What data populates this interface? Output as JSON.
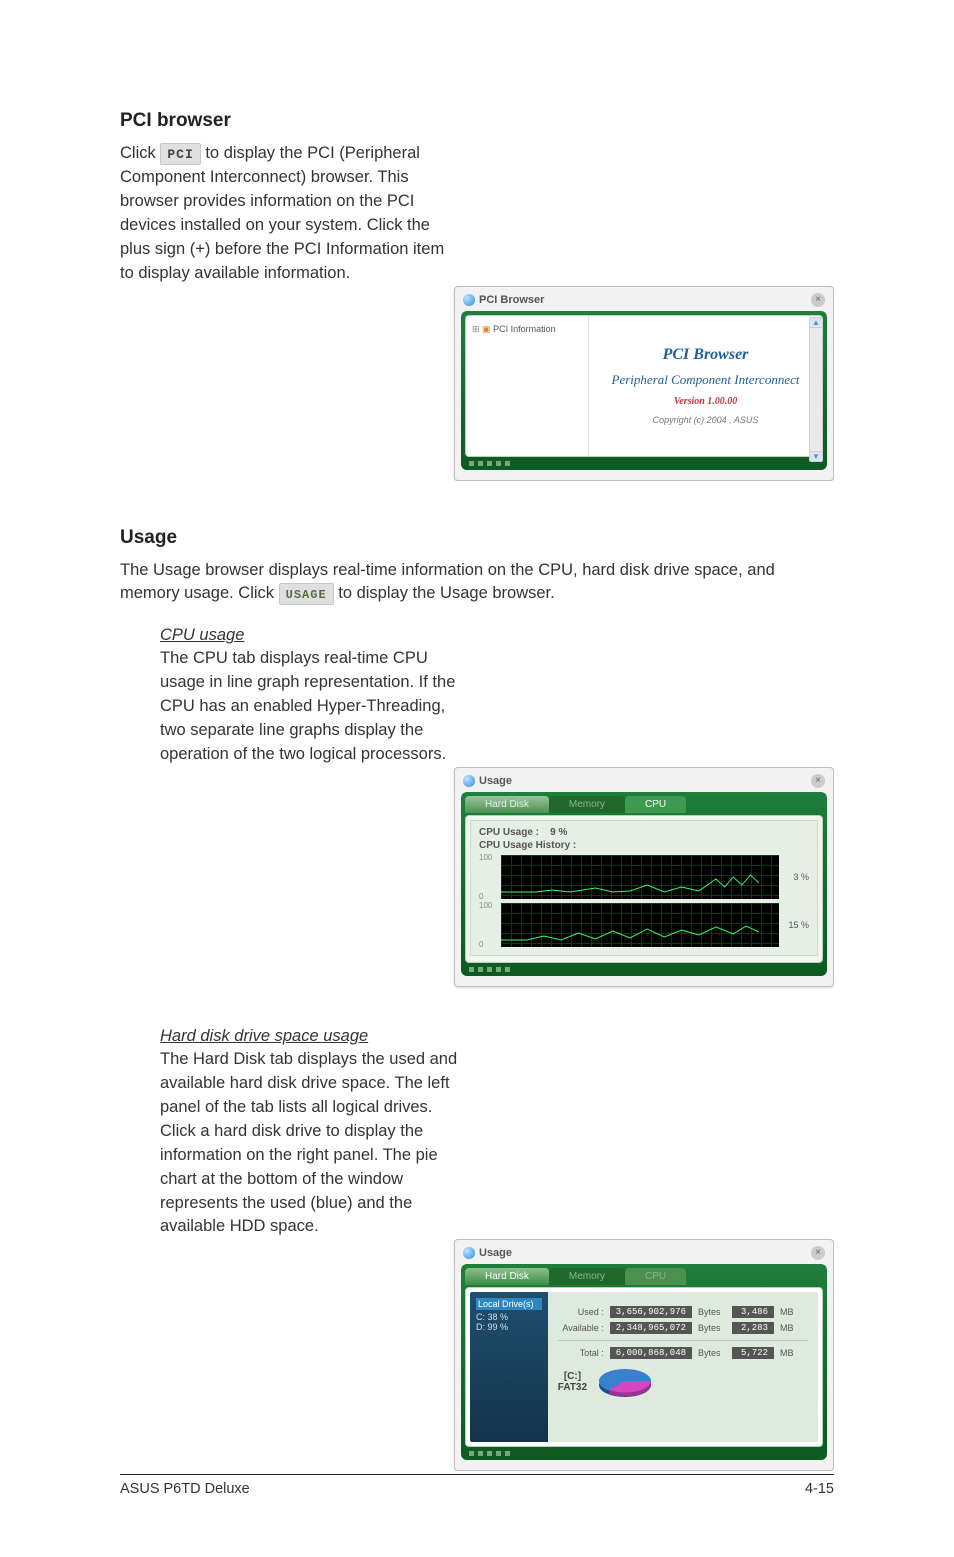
{
  "sections": {
    "pci": {
      "heading": "PCI browser",
      "para_before": "Click ",
      "button": "PCI",
      "para_after": " to display the PCI (Peripheral Component Interconnect) browser. This browser provides information on the PCI devices installed on your system. Click the plus sign (+) before the PCI Information item to display available information."
    },
    "usage": {
      "heading": "Usage",
      "intro_before": "The Usage browser displays real-time information on the CPU, hard disk drive space, and memory usage. Click ",
      "button": "USAGE",
      "intro_after": " to display the Usage browser.",
      "cpu": {
        "subhead": "CPU usage",
        "text": "The CPU tab displays real-time CPU usage in line graph representation. If the CPU has an enabled Hyper-Threading, two separate line graphs display the operation of the two logical processors."
      },
      "hdd": {
        "subhead": "Hard disk drive space usage",
        "text": "The Hard Disk tab displays the used and available hard disk drive space. The left panel of the tab lists all logical drives. Click a hard disk drive to display the information on the right panel. The pie chart at the bottom of the window represents the used (blue) and the available HDD space."
      }
    }
  },
  "win_pci": {
    "title": "PCI Browser",
    "tree_node": "PCI Information",
    "panel_title": "PCI Browser",
    "panel_sub": "Peripheral Component Interconnect",
    "version": "Version 1.00.00",
    "copy": "Copyright (c) 2004 , ASUS"
  },
  "win_cpu": {
    "title": "Usage",
    "tabs": {
      "hd": "Hard Disk",
      "mem": "Memory",
      "cpu": "CPU"
    },
    "cpu_usage_label": "CPU Usage :",
    "cpu_usage_value": "9  %",
    "history_label": "CPU Usage History :",
    "scale_top": "100",
    "scale_bot": "0",
    "pct_a": "3 %",
    "pct_b": "15 %"
  },
  "win_hdd": {
    "title": "Usage",
    "tabs": {
      "hd": "Hard Disk",
      "mem": "Memory",
      "cpu": "CPU"
    },
    "left": {
      "root": "Local Drive(s)",
      "c": "C:  38 %",
      "d": "D:  99 %"
    },
    "rows": {
      "used_label": "Used :",
      "used_bytes": "3,656,902,976",
      "used_mb": "3,486",
      "avail_label": "Available :",
      "avail_bytes": "2,348,965,072",
      "avail_mb": "2,283",
      "total_label": "Total :",
      "total_bytes": "6,000,868,048",
      "total_mb": "5,722",
      "unit_bytes": "Bytes",
      "unit_mb": "MB"
    },
    "drive_label_1": "[C:]",
    "drive_label_2": "FAT32"
  },
  "footer": {
    "left": "ASUS P6TD Deluxe",
    "right": "4-15"
  }
}
